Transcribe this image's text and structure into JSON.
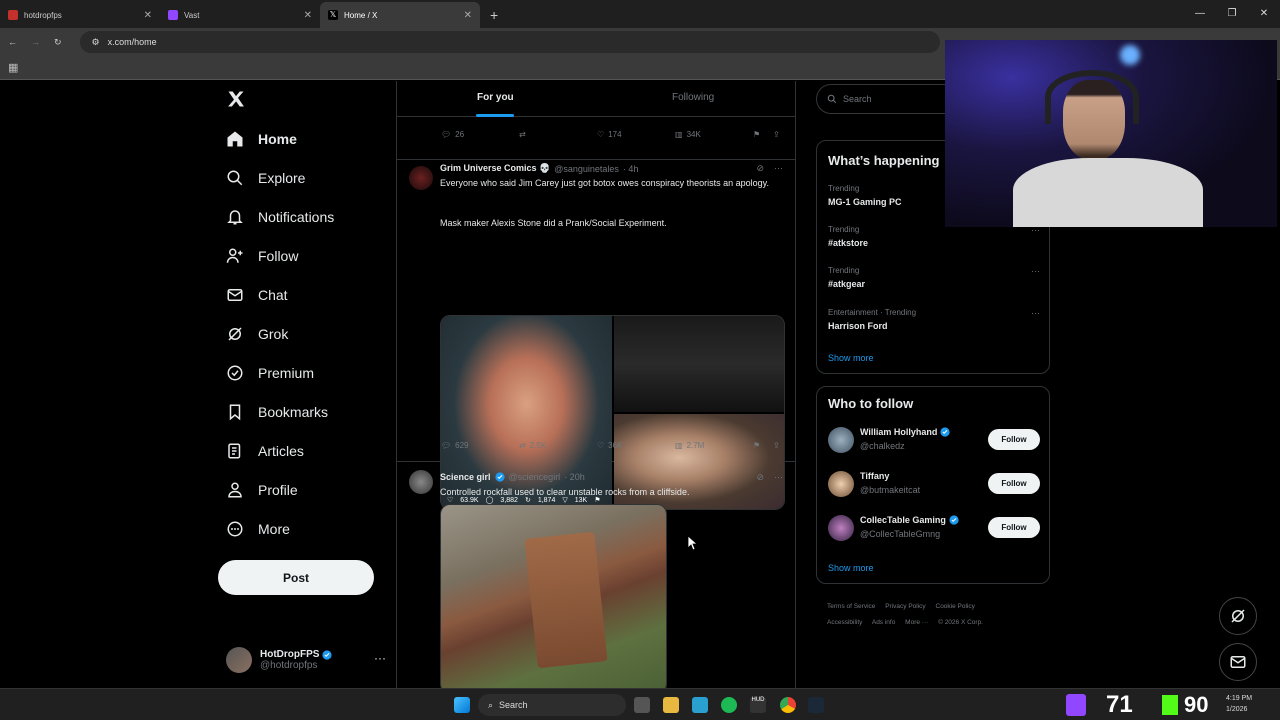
{
  "browser": {
    "tabs": [
      {
        "title": "hotdropfps",
        "color": "#c4302b"
      },
      {
        "title": "Vast",
        "color": "#9146ff"
      },
      {
        "title": "Home / X",
        "color": "#ffffff"
      }
    ],
    "url": "x.com/home"
  },
  "leftnav": {
    "items": [
      {
        "label": "Home",
        "icon": "home-icon"
      },
      {
        "label": "Explore",
        "icon": "search-icon"
      },
      {
        "label": "Notifications",
        "icon": "bell-icon"
      },
      {
        "label": "Follow",
        "icon": "person-add-icon"
      },
      {
        "label": "Chat",
        "icon": "mail-icon"
      },
      {
        "label": "Grok",
        "icon": "grok-icon"
      },
      {
        "label": "Premium",
        "icon": "premium-icon"
      },
      {
        "label": "Bookmarks",
        "icon": "bookmark-icon"
      },
      {
        "label": "Articles",
        "icon": "articles-icon"
      },
      {
        "label": "Profile",
        "icon": "person-icon"
      },
      {
        "label": "More",
        "icon": "more-circle-icon"
      }
    ],
    "post_label": "Post",
    "account": {
      "name": "HotDropFPS",
      "handle": "@hotdropfps"
    }
  },
  "timeline": {
    "tabs": [
      {
        "label": "For you"
      },
      {
        "label": "Following"
      }
    ],
    "prev_actions": {
      "replies": "26",
      "reposts": "",
      "likes": "174",
      "views": "34K"
    },
    "tweets": [
      {
        "name": "Grim Universe Comics 💀",
        "handle": "@sanguinetales",
        "time": "· 4h",
        "text1": "Everyone who said Jim Carey just got botox owes conspiracy theorists an apology.",
        "text2": "Mask maker Alexis Stone did a Prank/Social Experiment.",
        "media_stats": {
          "likes": "63.9K",
          "comments": "3,882",
          "reposts": "1,874",
          "other": "13K"
        },
        "actions": {
          "replies": "629",
          "reposts": "2.5K",
          "likes": "36K",
          "views": "2.7M"
        }
      },
      {
        "name": "Science girl",
        "handle": "@sciencegirl",
        "time": "· 20h",
        "text1": "Controlled rockfall used to clear unstable rocks from a cliffside."
      }
    ]
  },
  "rightcol": {
    "search_placeholder": "Search",
    "happening_title": "What’s happening",
    "trends": [
      {
        "context": "Trending",
        "title": "MG-1 Gaming PC"
      },
      {
        "context": "Trending",
        "title": "#atkstore"
      },
      {
        "context": "Trending",
        "title": "#atkgear"
      },
      {
        "context": "Entertainment · Trending",
        "title": "Harrison Ford"
      }
    ],
    "show_more": "Show more",
    "wtf_title": "Who to follow",
    "follow_suggestions": [
      {
        "name": "William Hollyhand",
        "handle": "@chalkedz",
        "verified": true
      },
      {
        "name": "Tiffany",
        "handle": "@butmakeitcat",
        "verified": false
      },
      {
        "name": "CollecTable Gaming",
        "handle": "@CollecTableGmng",
        "verified": true
      }
    ],
    "follow_label": "Follow",
    "footer": [
      "Terms of Service",
      "Privacy Policy",
      "Cookie Policy",
      "Accessibility",
      "Ads info",
      "More ···",
      "© 2026 X Corp."
    ]
  },
  "taskbar": {
    "search_label": "Search",
    "twitch_count": "71",
    "kick_count": "90",
    "clock_time": "4:19 PM",
    "clock_date": "1/2026"
  },
  "colors": {
    "accent": "#1d9bf0",
    "background": "#000000",
    "text": "#e7e9ea",
    "muted": "#71767b"
  }
}
